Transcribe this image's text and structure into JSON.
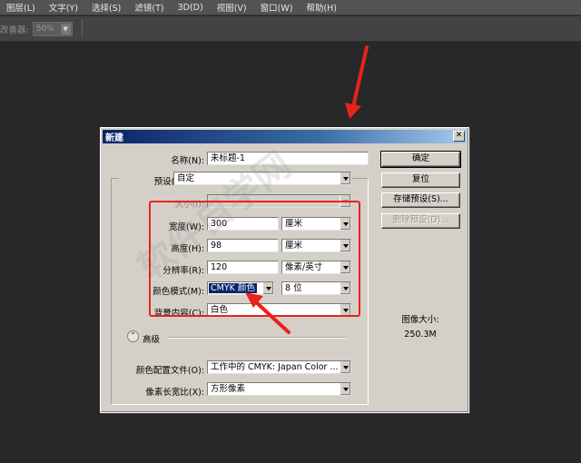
{
  "menubar": {
    "items": [
      "图层(L)",
      "文字(Y)",
      "选择(S)",
      "滤镜(T)",
      "3D(D)",
      "视图(V)",
      "窗口(W)",
      "帮助(H)"
    ]
  },
  "optionsbar": {
    "label": "改善器:",
    "value": "50%"
  },
  "dialog": {
    "title": "新建",
    "close": "✕",
    "name_label": "名称(N):",
    "name_value": "未标题-1",
    "preset_label": "预设(P):",
    "preset_value": "自定",
    "size_label": "大小(I):",
    "size_value": "",
    "width_label": "宽度(W):",
    "width_value": "300",
    "width_unit": "厘米",
    "height_label": "高度(H):",
    "height_value": "98",
    "height_unit": "厘米",
    "resolution_label": "分辨率(R):",
    "resolution_value": "120",
    "resolution_unit": "像素/英寸",
    "colormode_label": "颜色模式(M):",
    "colormode_value": "CMYK 颜色",
    "colormode_depth": "8 位",
    "bg_label": "背景内容(C):",
    "bg_value": "白色",
    "advanced_label": "高级",
    "profile_label": "颜色配置文件(O):",
    "profile_value": "工作中的 CMYK: Japan Color ...",
    "aspect_label": "像素长宽比(X):",
    "aspect_value": "方形像素",
    "buttons": {
      "ok": "确定",
      "reset": "复位",
      "save_preset": "存储预设(S)...",
      "delete_preset": "删除预设(D)..."
    },
    "image_size_label": "图像大小:",
    "image_size_value": "250.3M"
  },
  "watermark": "软件自学网",
  "colors": {
    "annotation": "#e8231b",
    "titlebar": "#0a246a",
    "selection": "#0a246a"
  }
}
